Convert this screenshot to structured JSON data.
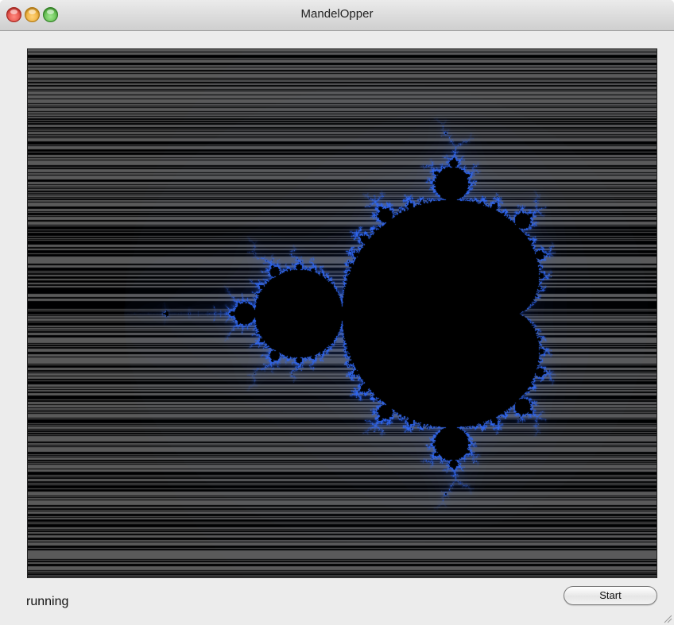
{
  "window": {
    "title": "MandelOpper"
  },
  "canvas": {
    "background": "#000000",
    "stripe_color": "#5a5a5a",
    "edge_color": "#4d7ff2"
  },
  "footer": {
    "status_text": "running",
    "start_label": "Start"
  }
}
